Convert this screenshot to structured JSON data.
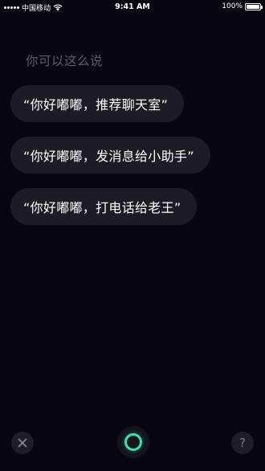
{
  "status_bar": {
    "carrier": "中国移动",
    "time": "9:41 AM",
    "battery": "100%",
    "battery_level": 1.0
  },
  "hint": "你可以这么说",
  "suggestions": [
    {
      "text": "“你好嘟嘟，推荐聊天室”"
    },
    {
      "text": "“你好嘟嘟，发消息给小助手”"
    },
    {
      "text": "“你好嘟嘟，打电话给老王”"
    }
  ],
  "controls": {
    "close_icon": "close-icon",
    "mic_icon": "voice-ring-icon",
    "help_glyph": "?",
    "accent_color": "#2ee6ae"
  }
}
